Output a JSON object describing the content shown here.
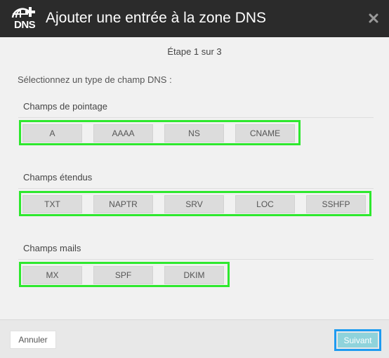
{
  "header": {
    "icon_text": "DNS",
    "title": "Ajouter une entrée à la zone DNS",
    "close_icon": "close-icon"
  },
  "step_text": "Étape 1 sur 3",
  "prompt": "Sélectionnez un type de champ DNS :",
  "sections": [
    {
      "title": "Champs de pointage",
      "buttons": [
        "A",
        "AAAA",
        "NS",
        "CNAME"
      ]
    },
    {
      "title": "Champs étendus",
      "buttons": [
        "TXT",
        "NAPTR",
        "SRV",
        "LOC",
        "SSHFP"
      ]
    },
    {
      "title": "Champs mails",
      "buttons": [
        "MX",
        "SPF",
        "DKIM"
      ]
    }
  ],
  "footer": {
    "cancel_label": "Annuler",
    "next_label": "Suivant"
  },
  "colors": {
    "header_bg": "#2b2b2b",
    "highlight_green": "#2ee82e",
    "highlight_blue": "#1e9bf0",
    "next_button": "#8fd3db"
  }
}
